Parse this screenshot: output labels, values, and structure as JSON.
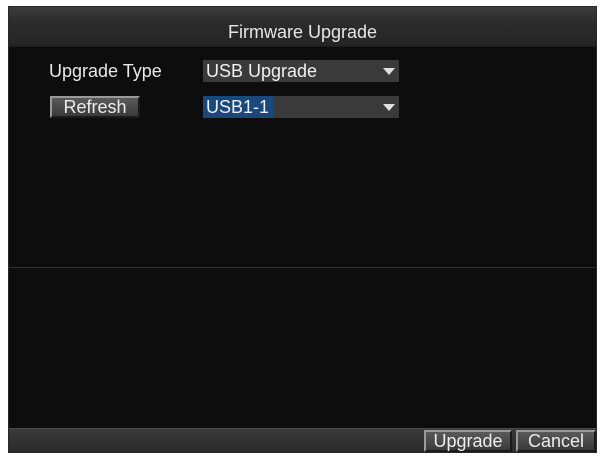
{
  "dialog": {
    "title": "Firmware Upgrade"
  },
  "upgrade_type": {
    "label": "Upgrade Type",
    "selected": "USB Upgrade"
  },
  "device": {
    "refresh_label": "Refresh",
    "selected": "USB1-1"
  },
  "footer": {
    "upgrade_label": "Upgrade",
    "cancel_label": "Cancel"
  },
  "icons": {
    "dropdown": "chevron-down-icon"
  },
  "colors": {
    "background": "#0d0d0d",
    "bar": "#2c2c2c",
    "selection": "#17497f",
    "text": "#e8e8e8"
  }
}
